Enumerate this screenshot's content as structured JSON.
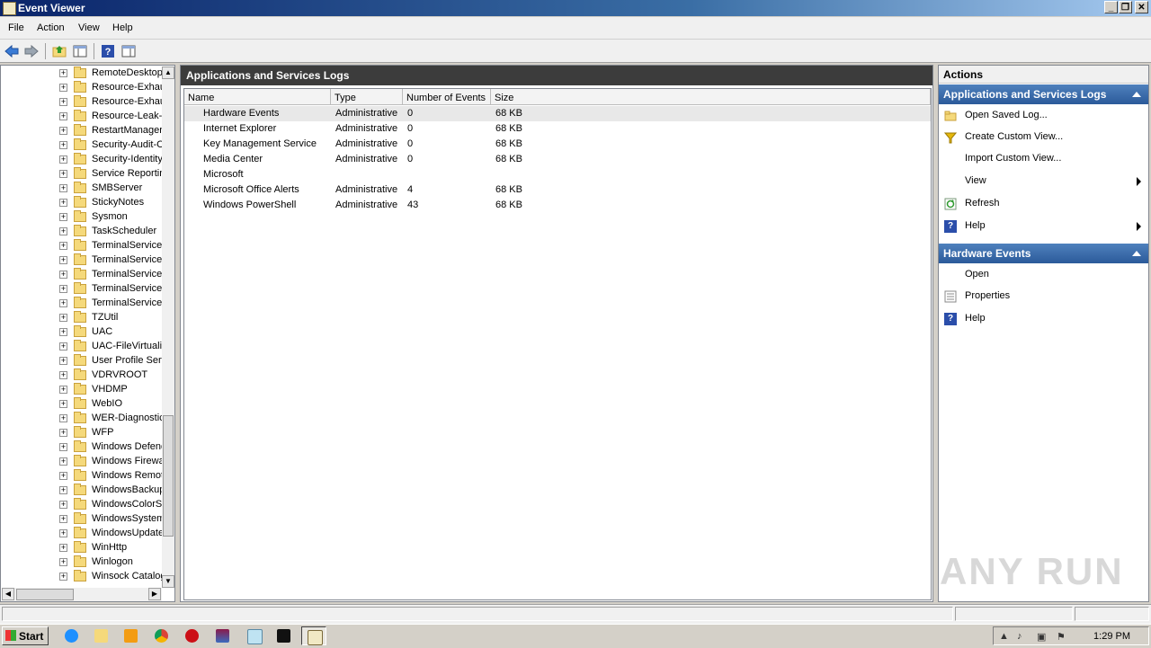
{
  "window": {
    "title": "Event Viewer"
  },
  "menu": [
    "File",
    "Action",
    "View",
    "Help"
  ],
  "tree": {
    "items": [
      "RemoteDesktopS",
      "Resource-Exhau",
      "Resource-Exhau",
      "Resource-Leak-I",
      "RestartManager",
      "Security-Audit-C",
      "Security-Identity",
      "Service Reportin",
      "SMBServer",
      "StickyNotes",
      "Sysmon",
      "TaskScheduler",
      "TerminalServices",
      "TerminalServices",
      "TerminalServices",
      "TerminalServices",
      "TerminalServices",
      "TZUtil",
      "UAC",
      "UAC-FileVirtualiz",
      "User Profile Serv",
      "VDRVROOT",
      "VHDMP",
      "WebIO",
      "WER-Diagnostics",
      "WFP",
      "Windows Defend",
      "Windows Firewa",
      "Windows Remot",
      "WindowsBackup",
      "WindowsColorSy",
      "WindowsSystem",
      "WindowsUpdate",
      "WinHttp",
      "Winlogon",
      "Winsock Catalog"
    ]
  },
  "center": {
    "header": "Applications and Services Logs",
    "columns": [
      "Name",
      "Type",
      "Number of Events",
      "Size"
    ],
    "rows": [
      {
        "name": "Hardware Events",
        "type": "Administrative",
        "count": "0",
        "size": "68 KB"
      },
      {
        "name": "Internet Explorer",
        "type": "Administrative",
        "count": "0",
        "size": "68 KB"
      },
      {
        "name": "Key Management Service",
        "type": "Administrative",
        "count": "0",
        "size": "68 KB"
      },
      {
        "name": "Media Center",
        "type": "Administrative",
        "count": "0",
        "size": "68 KB"
      },
      {
        "name": "Microsoft",
        "type": "",
        "count": "",
        "size": ""
      },
      {
        "name": "Microsoft Office Alerts",
        "type": "Administrative",
        "count": "4",
        "size": "68 KB"
      },
      {
        "name": "Windows PowerShell",
        "type": "Administrative",
        "count": "43",
        "size": "68 KB"
      }
    ]
  },
  "actions": {
    "title": "Actions",
    "section1": {
      "header": "Applications and Services Logs",
      "items": [
        "Open Saved Log...",
        "Create Custom View...",
        "Import Custom View...",
        "View",
        "Refresh",
        "Help"
      ]
    },
    "section2": {
      "header": "Hardware Events",
      "items": [
        "Open",
        "Properties",
        "Help"
      ]
    }
  },
  "watermark": "ANY RUN",
  "taskbar": {
    "start": "Start",
    "clock": "1:29 PM"
  }
}
